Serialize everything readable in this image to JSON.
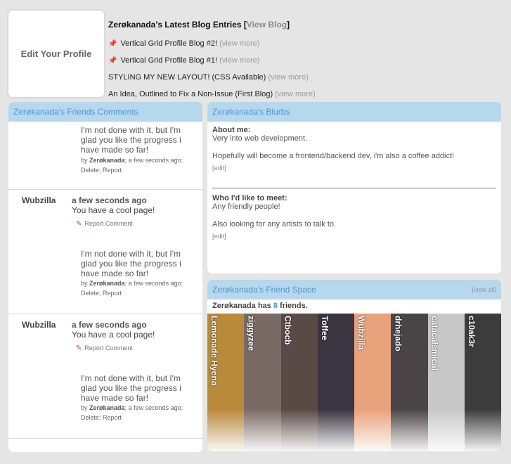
{
  "profile": {
    "edit_label": "Edit Your Profile"
  },
  "blog": {
    "title_prefix": "Zerøkanada's Latest Blog Entries [",
    "view_blog": "View Blog",
    "title_suffix": "]",
    "entries": [
      {
        "pin": "📌",
        "title": "Vertical Grid Profile Blog #2!",
        "more": "(view more)"
      },
      {
        "pin": "📌",
        "title": "Vertical Grid Profile Blog #1!",
        "more": "(view more)"
      },
      {
        "pin": "",
        "title": "STYLING MY NEW LAYOUT! (CSS Available)",
        "more": "(view more)"
      },
      {
        "pin": "",
        "title": "An Idea, Outlined to Fix a Non-Issue (First Blog)",
        "more": "(view more)"
      }
    ]
  },
  "comments": {
    "title": "Zerøkanada's Friends Comments",
    "top_reply": {
      "text": "I'm not done with it, but I'm glad you like the progress i have made so far!",
      "by": "by",
      "author": "Zerøkanada",
      "meta": "; a few seconds ago; Delete; Report"
    },
    "items": [
      {
        "user": "Wubzilla",
        "time": "a few seconds ago",
        "text": "You have a cool page!",
        "report": "Report Comment",
        "reply": {
          "text": "I'm not done with it, but I'm glad you like the progress i have made so far!",
          "by": "by",
          "author": "Zerøkanada",
          "meta": "; a few seconds ago; Delete; Report"
        }
      },
      {
        "user": "Wubzilla",
        "time": "a few seconds ago",
        "text": "You have a cool page!",
        "report": "Report Comment",
        "reply": {
          "text": "I'm not done with it, but I'm glad you like the progress i have made so far!",
          "by": "by",
          "author": "Zerøkanada",
          "meta": "; a few seconds ago; Delete; Report"
        }
      }
    ]
  },
  "blurbs": {
    "title": "Zerøkanada's Blurbs",
    "about": {
      "heading": "About me:",
      "line1": "Very into web development.",
      "line2": "Hopefully will become a frontend/backend dev, i'm also a coffee addict!",
      "edit": "[edit]"
    },
    "meet": {
      "heading": "Who I'd like to meet:",
      "line1": "Any friendly people!",
      "line2": "Also looking for any artists to talk to.",
      "edit": "[edit]"
    }
  },
  "friends": {
    "title": "Zerøkanada's Friend Space",
    "view_all": "[view all]",
    "owner": "Zerøkanada",
    "has": "has",
    "count": "8",
    "suffix": "friends.",
    "list": [
      {
        "name": "Lemonade Hyena",
        "color": "#b88a3a"
      },
      {
        "name": "ziggyzee",
        "color": "#7a6a66"
      },
      {
        "name": "Ctbocb",
        "color": "#5a4a46"
      },
      {
        "name": "Toffee",
        "color": "#3a3540"
      },
      {
        "name": "Wubzilla",
        "color": "#e8a27c"
      },
      {
        "name": "drhejado",
        "color": "#4a4446"
      },
      {
        "name": "catacalsmical",
        "color": "#c8c8c8"
      },
      {
        "name": "c10ak3r",
        "color": "#3c3c3c"
      }
    ]
  }
}
